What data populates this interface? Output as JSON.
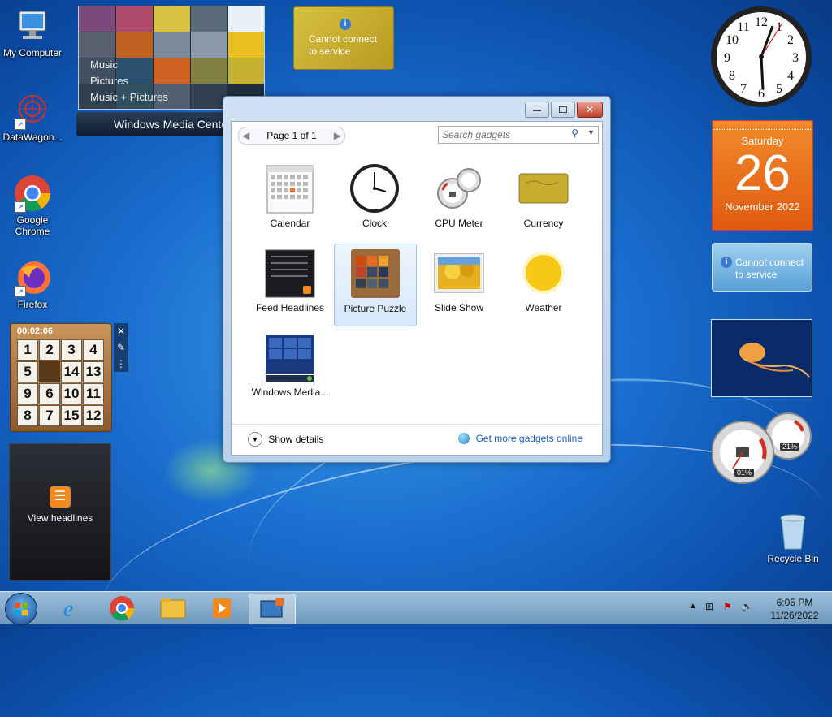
{
  "desktop": {
    "icons": [
      {
        "label": "My Computer"
      },
      {
        "label": "DataWagon..."
      },
      {
        "label": "Google Chrome"
      },
      {
        "label": "Firefox"
      }
    ],
    "recycle_bin": "Recycle Bin"
  },
  "media_center": {
    "items": [
      "Music",
      "Pictures",
      "Music + Pictures"
    ],
    "title": "Windows Media Center"
  },
  "currency_top": {
    "message": "Cannot connect to service"
  },
  "gadgets_window": {
    "page_label": "Page 1 of 1",
    "search_placeholder": "Search gadgets",
    "gadgets": [
      {
        "label": "Calendar"
      },
      {
        "label": "Clock"
      },
      {
        "label": "CPU Meter"
      },
      {
        "label": "Currency"
      },
      {
        "label": "Feed Headlines"
      },
      {
        "label": "Picture Puzzle"
      },
      {
        "label": "Slide Show"
      },
      {
        "label": "Weather"
      },
      {
        "label": "Windows Media..."
      }
    ],
    "show_details": "Show details",
    "get_more": "Get more gadgets online"
  },
  "calendar_gadget": {
    "weekday": "Saturday",
    "day": "26",
    "month_year": "November 2022"
  },
  "weather_gadget": {
    "message": "Cannot connect to service"
  },
  "cpu_gadget": {
    "cpu": "01%",
    "memory": "21%"
  },
  "puzzle": {
    "timer": "00:02:06",
    "tiles": [
      "1",
      "2",
      "3",
      "4",
      "5",
      "",
      "14",
      "13",
      "9",
      "6",
      "10",
      "11",
      "8",
      "7",
      "15",
      "12"
    ]
  },
  "feed": {
    "label": "View headlines"
  },
  "taskbar": {
    "time": "6:05 PM",
    "date": "11/26/2022"
  },
  "colors": {
    "accent": "#1a6fd0",
    "calendar": "#e8661a",
    "link": "#1a5fc0"
  }
}
